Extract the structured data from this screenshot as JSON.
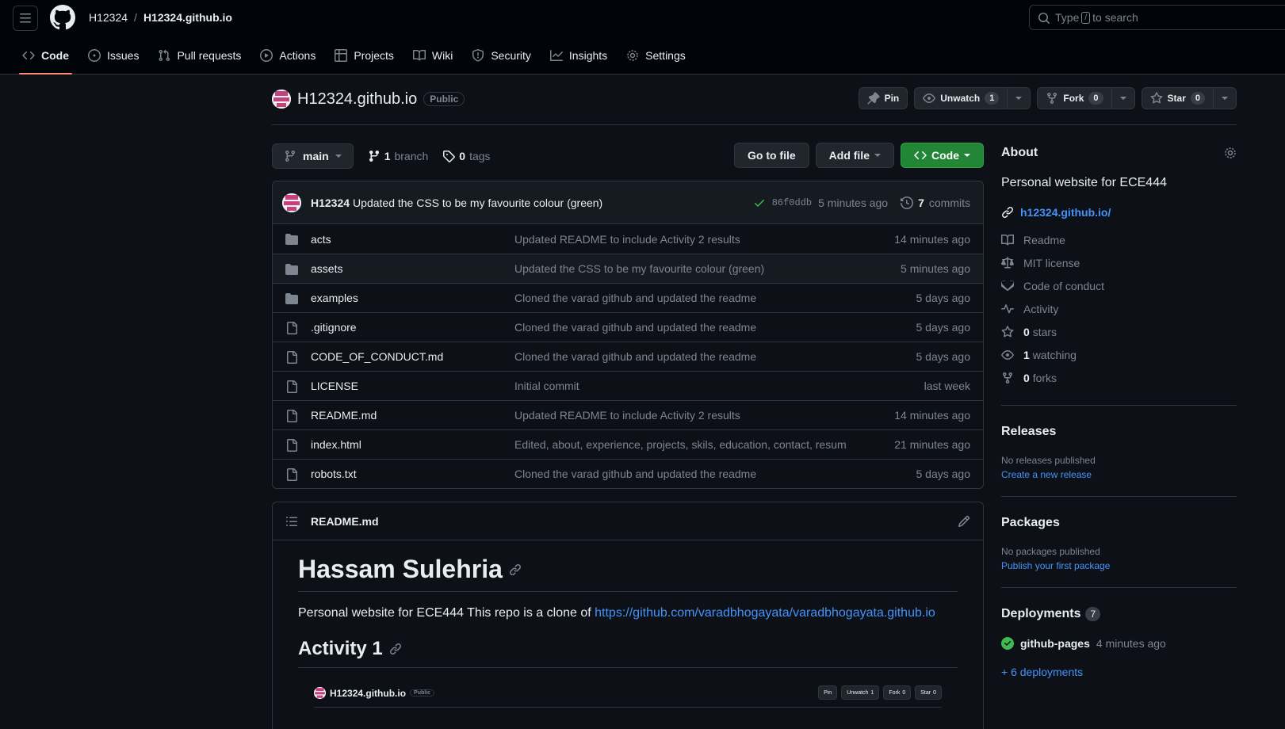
{
  "header": {
    "owner": "H12324",
    "separator": "/",
    "repo": "H12324.github.io",
    "search_prefix": "Type",
    "search_key": "/",
    "search_suffix": "to search"
  },
  "tabs": [
    {
      "label": "Code",
      "icon": "code-icon"
    },
    {
      "label": "Issues",
      "icon": "issue-icon"
    },
    {
      "label": "Pull requests",
      "icon": "pull-request-icon"
    },
    {
      "label": "Actions",
      "icon": "play-icon"
    },
    {
      "label": "Projects",
      "icon": "table-icon"
    },
    {
      "label": "Wiki",
      "icon": "book-icon"
    },
    {
      "label": "Security",
      "icon": "shield-icon"
    },
    {
      "label": "Insights",
      "icon": "graph-icon"
    },
    {
      "label": "Settings",
      "icon": "gear-icon"
    }
  ],
  "repo_header": {
    "name": "H12324.github.io",
    "visibility": "Public",
    "pin_label": "Pin",
    "unwatch_label": "Unwatch",
    "unwatch_count": "1",
    "fork_label": "Fork",
    "fork_count": "0",
    "star_label": "Star",
    "star_count": "0"
  },
  "file_nav": {
    "branch": "main",
    "branch_count": "1",
    "branch_label": "branch",
    "tag_count": "0",
    "tag_label": "tags",
    "go_to_file": "Go to file",
    "add_file": "Add file",
    "code": "Code"
  },
  "latest_commit": {
    "author": "H12324",
    "message": "Updated the CSS to be my favourite colour (green)",
    "sha": "86f0ddb",
    "time": "5 minutes ago",
    "commit_count": "7",
    "commit_label": "commits"
  },
  "files": [
    {
      "name": "acts",
      "type": "dir",
      "message": "Updated README to include Activity 2 results",
      "age": "14 minutes ago"
    },
    {
      "name": "assets",
      "type": "dir",
      "message": "Updated the CSS to be my favourite colour (green)",
      "age": "5 minutes ago"
    },
    {
      "name": "examples",
      "type": "dir",
      "message": "Cloned the varad github and updated the readme",
      "age": "5 days ago"
    },
    {
      "name": ".gitignore",
      "type": "file",
      "message": "Cloned the varad github and updated the readme",
      "age": "5 days ago"
    },
    {
      "name": "CODE_OF_CONDUCT.md",
      "type": "file",
      "message": "Cloned the varad github and updated the readme",
      "age": "5 days ago"
    },
    {
      "name": "LICENSE",
      "type": "file",
      "message": "Initial commit",
      "age": "last week"
    },
    {
      "name": "README.md",
      "type": "file",
      "message": "Updated README to include Activity 2 results",
      "age": "14 minutes ago"
    },
    {
      "name": "index.html",
      "type": "file",
      "message": "Edited, about, experience, projects, skils, education, contact, resum...",
      "age": "21 minutes ago"
    },
    {
      "name": "robots.txt",
      "type": "file",
      "message": "Cloned the varad github and updated the readme",
      "age": "5 days ago"
    }
  ],
  "readme": {
    "filename": "README.md",
    "heading": "Hassam Sulehria",
    "text": "Personal website for ECE444 This repo is a clone of",
    "link": "https://github.com/varadbhogayata/varadbhogayata.github.io",
    "subheading": "Activity 1",
    "mini": {
      "repo": "H12324.github.io",
      "visibility": "Public",
      "pin": "Pin",
      "unwatch": "Unwatch",
      "unwatch_count": "1",
      "fork": "Fork",
      "fork_count": "0",
      "star": "Star",
      "star_count": "0"
    }
  },
  "sidebar": {
    "about_title": "About",
    "description": "Personal website for ECE444",
    "homepage": "h12324.github.io/",
    "items": [
      {
        "icon": "book-icon",
        "bold": "",
        "label": "Readme"
      },
      {
        "icon": "law-icon",
        "bold": "",
        "label": "MIT license"
      },
      {
        "icon": "code-of-conduct-icon",
        "bold": "",
        "label": "Code of conduct"
      },
      {
        "icon": "pulse-icon",
        "bold": "",
        "label": "Activity"
      },
      {
        "icon": "star-icon",
        "bold": "0",
        "label": "stars"
      },
      {
        "icon": "eye-icon",
        "bold": "1",
        "label": "watching"
      },
      {
        "icon": "fork-icon",
        "bold": "0",
        "label": "forks"
      }
    ],
    "releases_title": "Releases",
    "releases_none": "No releases published",
    "releases_link": "Create a new release",
    "packages_title": "Packages",
    "packages_none": "No packages published",
    "packages_link": "Publish your first package",
    "deployments_title": "Deployments",
    "deployments_count": "7",
    "deployment_name": "github-pages",
    "deployment_time": "4 minutes ago",
    "more_deployments": "+ 6 deployments"
  },
  "colors": {
    "bg": "#0d1117",
    "header_bg": "#010409",
    "accent_link": "#4493f8",
    "green_button": "#238636",
    "active_tab": "#fd8c73"
  }
}
